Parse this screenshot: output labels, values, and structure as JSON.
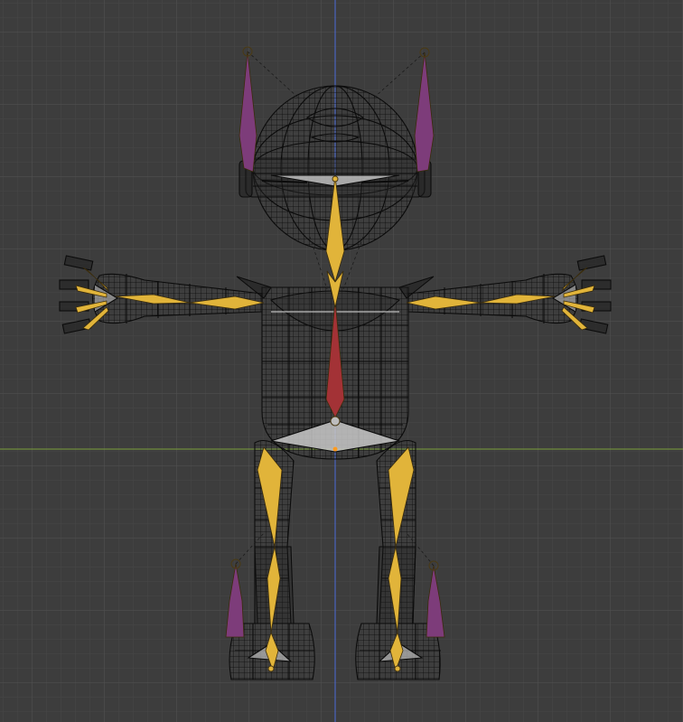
{
  "viewport": {
    "view": "front-orthographic",
    "shading": "wireframe",
    "grid": true
  },
  "colors": {
    "background": "#3d3d3d",
    "grid_minor": "#474747",
    "grid_major": "#545454",
    "x_axis": "#7a9f3c",
    "z_axis": "#4c6ad6",
    "wire": "#0b0b0b",
    "bone_deform": "#e1b43a",
    "bone_ik": "#7d3c7a",
    "bone_active": "#a33236",
    "bone_light": "#bdbdbd"
  },
  "scene": {
    "mesh": "character-mesh",
    "armature": "character-armature",
    "bones": [
      "spine",
      "neck-head",
      "upper-arm-left",
      "forearm-left",
      "hand-left",
      "upper-arm-right",
      "forearm-right",
      "hand-right",
      "thigh-left",
      "shin-left",
      "foot-left",
      "thigh-right",
      "shin-right",
      "foot-right",
      "ik-ear-left",
      "ik-ear-right",
      "ik-leg-left",
      "ik-leg-right"
    ]
  }
}
